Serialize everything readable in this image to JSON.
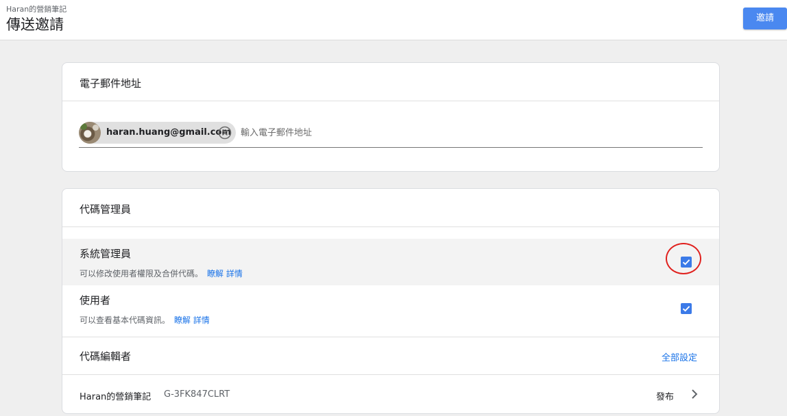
{
  "header": {
    "account_name": "Haran的營銷筆記",
    "page_title": "傳送邀請",
    "invite_button": "邀請"
  },
  "email_section": {
    "title": "電子郵件地址",
    "chips": [
      {
        "email": "haran.huang@gmail.com"
      }
    ],
    "input_placeholder": "輸入電子郵件地址",
    "input_value": ""
  },
  "roles_section": {
    "title": "代碼管理員",
    "roles": [
      {
        "name": "系統管理員",
        "description": "可以修改使用者權限及合併代碼。",
        "link": "瞭解 詳情",
        "checked": true,
        "highlighted": true
      },
      {
        "name": "使用者",
        "description": "可以查看基本代碼資訊。",
        "link": "瞭解 詳情",
        "checked": true,
        "highlighted": false
      }
    ],
    "editor_label": "代碼編輯者",
    "set_all_label": "全部設定",
    "container": {
      "name": "Haran的營銷筆記",
      "id": "G-3FK847CLRT",
      "permission": "發布"
    }
  },
  "colors": {
    "primary": "#4a88f0",
    "link": "#1a73e8",
    "checkbox": "#3b7ae8",
    "annotation": "#e0201d",
    "background": "#efefef"
  }
}
